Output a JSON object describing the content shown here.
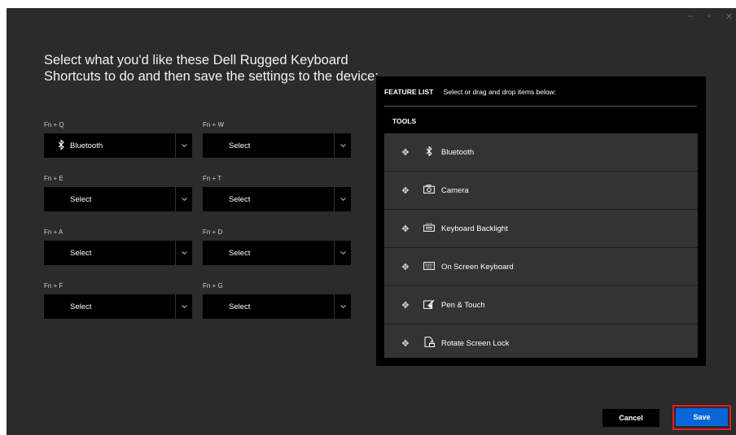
{
  "window": {
    "controls": [
      "–",
      "▫",
      "✕"
    ]
  },
  "heading": "Select what you'd like these Dell Rugged Keyboard Shortcuts to do and then save the settings to the device:",
  "slots": [
    {
      "label": "Fn + Q",
      "value": "Bluetooth",
      "icon": "bluetooth-icon"
    },
    {
      "label": "Fn + W",
      "value": "Select"
    },
    {
      "label": "Fn + E",
      "value": "Select"
    },
    {
      "label": "Fn + T",
      "value": "Select"
    },
    {
      "label": "Fn + A",
      "value": "Select"
    },
    {
      "label": "Fn + D",
      "value": "Select"
    },
    {
      "label": "Fn + F",
      "value": "Select"
    },
    {
      "label": "Fn + G",
      "value": "Select"
    }
  ],
  "feature_list": {
    "title": "FEATURE LIST",
    "instructions": "Select or drag and drop items below:",
    "section": "TOOLS",
    "items": [
      {
        "label": "Bluetooth",
        "icon": "bluetooth-icon"
      },
      {
        "label": "Camera",
        "icon": "camera-icon"
      },
      {
        "label": "Keyboard Backlight",
        "icon": "keyboard-backlight-icon"
      },
      {
        "label": "On Screen Keyboard",
        "icon": "keyboard-icon"
      },
      {
        "label": "Pen & Touch",
        "icon": "pen-touch-icon"
      },
      {
        "label": "Rotate Screen Lock",
        "icon": "rotate-lock-icon"
      }
    ]
  },
  "buttons": {
    "cancel": "Cancel",
    "save": "Save"
  },
  "colors": {
    "background": "#2b2b2b",
    "panel": "#000000",
    "save": "#0a66d6",
    "highlight": "#e8192c"
  }
}
